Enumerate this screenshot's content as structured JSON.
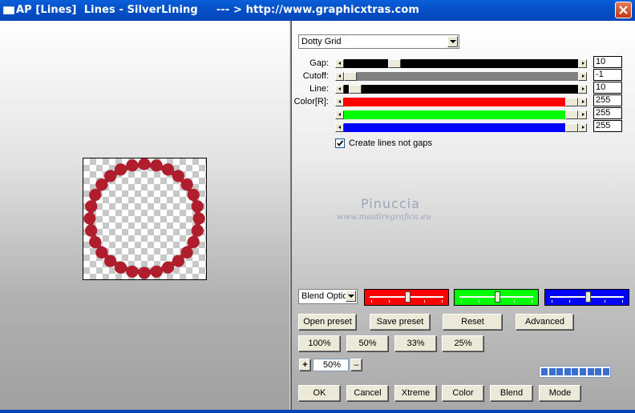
{
  "window": {
    "title": "AP [Lines]  Lines - SilverLining     --- > http://www.graphicxtras.com",
    "icon": "window-icon",
    "close_icon": "close-icon"
  },
  "preset_combo": {
    "value": "Dotty Grid"
  },
  "sliders": [
    {
      "label": "Gap:",
      "value": "10",
      "track_color": "#000000",
      "level": 0.2
    },
    {
      "label": "Cutoff:",
      "value": "-1",
      "track_color": "#808080",
      "level": 0.0
    },
    {
      "label": "Line:",
      "value": "10",
      "track_color": "#000000",
      "level": 0.02
    },
    {
      "label": "Color[R]:",
      "value": "255",
      "track_color": "#ff0000",
      "level": 1.0
    },
    {
      "label": "",
      "value": "255",
      "track_color": "#00ff00",
      "level": 1.0
    },
    {
      "label": "",
      "value": "255",
      "track_color": "#0000ff",
      "level": 1.0
    }
  ],
  "checkbox": {
    "label": "Create lines not gaps",
    "checked": true
  },
  "watermark": {
    "line1": "Pinuccia",
    "line2": "www.maidiregrafica.eu"
  },
  "blend_combo": {
    "value": "Blend Optio"
  },
  "color_boxes": [
    {
      "color": "#ff0000",
      "level": 0.5
    },
    {
      "color": "#00ff00",
      "level": 0.5
    },
    {
      "color": "#0000ff",
      "level": 0.5
    }
  ],
  "preset_buttons": {
    "open": "Open preset",
    "save": "Save preset",
    "reset": "Reset",
    "advanced": "Advanced"
  },
  "zoom_buttons": [
    "100%",
    "50%",
    "33%",
    "25%"
  ],
  "zoom": {
    "plus": "+",
    "value": "50%",
    "minus": "–"
  },
  "progress_segments": 9,
  "bottom_buttons": [
    "OK",
    "Cancel",
    "Xtreme",
    "Color",
    "Blend",
    "Mode"
  ],
  "preview": {
    "ring_color": "#b01e2e"
  }
}
